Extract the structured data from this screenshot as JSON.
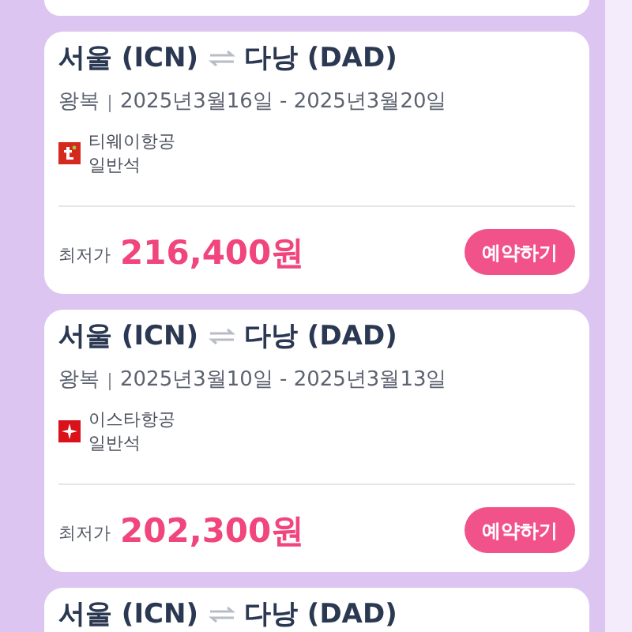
{
  "flights": [
    {
      "origin": "서울 (ICN)",
      "destination": "다낭 (DAD)",
      "trip_type": "왕복",
      "dates": "2025년3월16일 - 2025년3월20일",
      "airline": {
        "name": "티웨이항공",
        "kind": "tway"
      },
      "seat_class": "일반석",
      "price_label": "최저가",
      "price": "216,400원",
      "button": "예약하기"
    },
    {
      "origin": "서울 (ICN)",
      "destination": "다낭 (DAD)",
      "trip_type": "왕복",
      "dates": "2025년3월10일 - 2025년3월13일",
      "airline": {
        "name": "이스타항공",
        "kind": "star"
      },
      "seat_class": "일반석",
      "price_label": "최저가",
      "price": "202,300원",
      "button": "예약하기"
    },
    {
      "origin": "서울 (ICN)",
      "destination": "다낭 (DAD)"
    }
  ]
}
